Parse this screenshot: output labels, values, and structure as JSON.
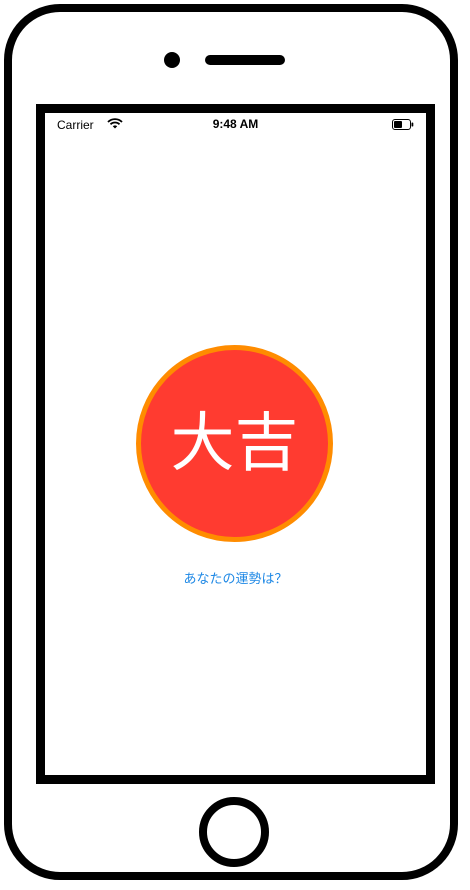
{
  "status_bar": {
    "carrier": "Carrier",
    "time": "9:48 AM",
    "wifi_icon": "wifi-icon",
    "battery_icon": "battery-icon"
  },
  "fortune": {
    "result": "大吉",
    "circle_fill_color": "#FF3B30",
    "circle_border_color": "#FF8C00",
    "text_color": "#FFFFFF"
  },
  "prompt": {
    "label": "あなたの運勢は？",
    "color": "#1E88E5"
  }
}
